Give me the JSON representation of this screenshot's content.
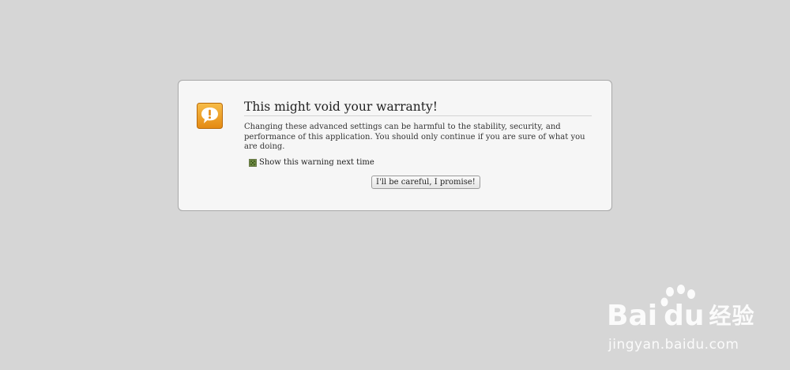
{
  "dialog": {
    "title": "This might void your warranty!",
    "description": "Changing these advanced settings can be harmful to the stability, security, and performance of this application. You should only continue if you are sure of what you are doing.",
    "checkbox": {
      "label": "Show this warning next time",
      "checked": true
    },
    "confirm_button_label": "I'll be careful, I promise!",
    "icon": "speech-bubble-exclamation-icon"
  },
  "watermark": {
    "brand_left": "Bai",
    "brand_right": "du",
    "brand_cn": "经验",
    "url": "jingyan.baidu.com"
  },
  "colors": {
    "page_background": "#d6d6d6",
    "dialog_background": "#f6f6f6",
    "icon_orange": "#f0a020",
    "checkbox_green": "#9cb86a"
  }
}
